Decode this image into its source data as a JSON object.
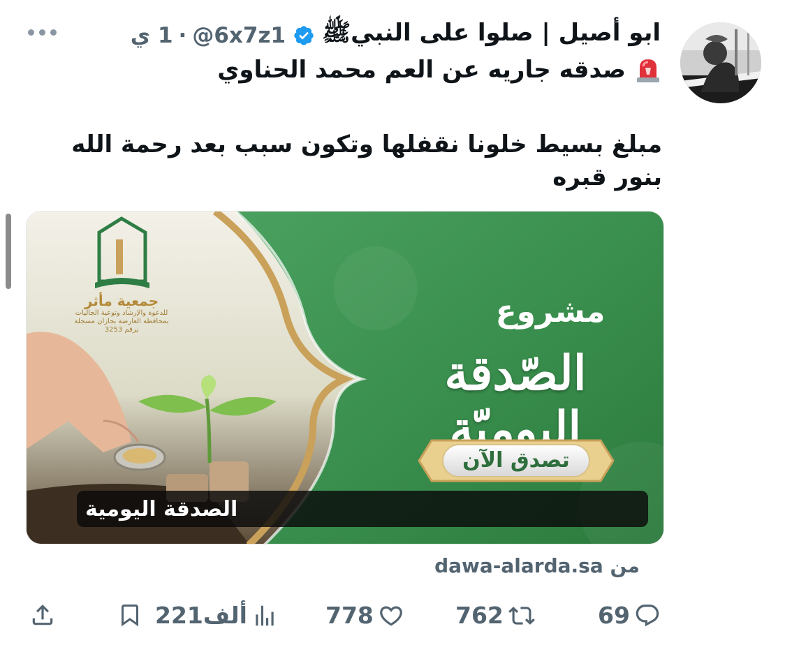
{
  "post": {
    "author_name": "ابو أصيل | صلوا على النبيﷺ",
    "handle": "@6x7z1",
    "separator": "·",
    "time": "1 ي",
    "subline": "صدقه جاريه عن العم محمد الحناوي",
    "body": "مبلغ بسيط خلونا نقفلها وتكون سبب بعد رحمة الله بنور قبره"
  },
  "card": {
    "project_label": "مشروع",
    "project_title": "الصّدقة اليوميّة",
    "donate_button": "تصدق الآن",
    "org_name": "جمعية مأثر",
    "org_subtitle": "للدعوة والإرشاد وتوعية الجاليات بمحافظة العارضة بجازان مسجلة برقم 3253",
    "caption": "الصدقة اليومية",
    "source": "من dawa-alarda.sa"
  },
  "actions": {
    "replies": "69",
    "reposts": "762",
    "likes": "778",
    "views": "221ألف"
  },
  "icons": {
    "more": "more-icon",
    "verified": "verified-badge-icon",
    "siren": "siren-emoji-icon",
    "reply": "reply-icon",
    "repost": "repost-icon",
    "like": "heart-icon",
    "views": "views-icon",
    "bookmark": "bookmark-icon",
    "share": "share-icon"
  },
  "colors": {
    "verified_blue": "#1d9bf0",
    "muted": "#536471",
    "banner_green": "#3a8f4e",
    "gold": "#c9a15a"
  }
}
